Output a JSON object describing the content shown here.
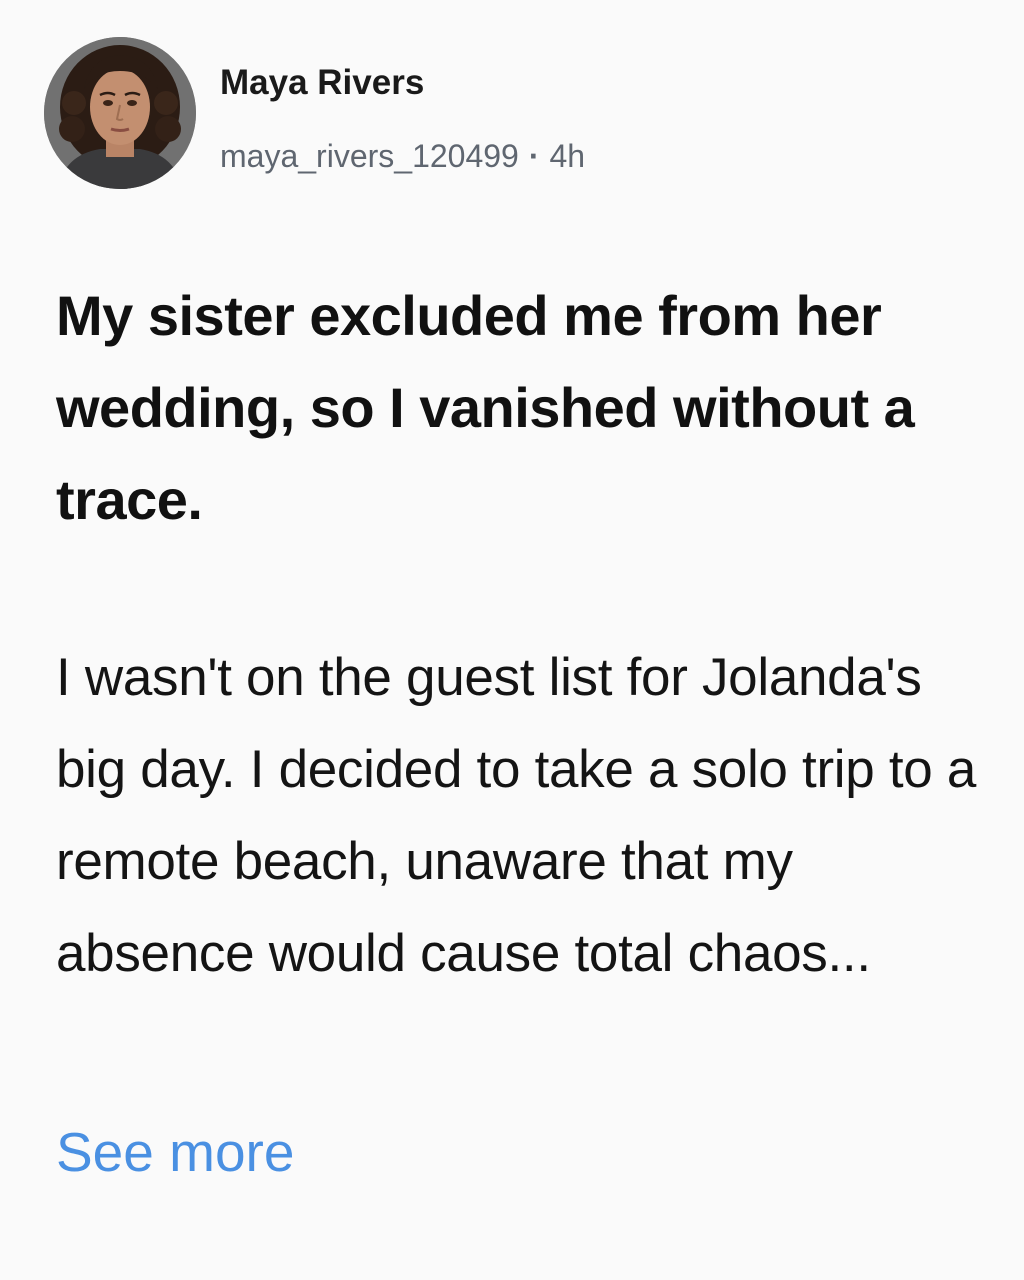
{
  "post": {
    "author": {
      "name": "Maya Rivers",
      "handle": "maya_rivers_120499",
      "separator": "·",
      "time": "4h",
      "avatar_icon": "profile-photo"
    },
    "headline": "My sister excluded me from her wedding, so I vanished without a trace.",
    "body": "I wasn't on the guest list for Jolanda's big day. I decided to take a solo trip to a remote beach, unaware that my absence would cause total chaos...",
    "see_more_label": "See more"
  },
  "colors": {
    "background": "#fafafa",
    "text": "#111111",
    "secondary_text": "#5f6670",
    "link": "#4a90e2"
  }
}
